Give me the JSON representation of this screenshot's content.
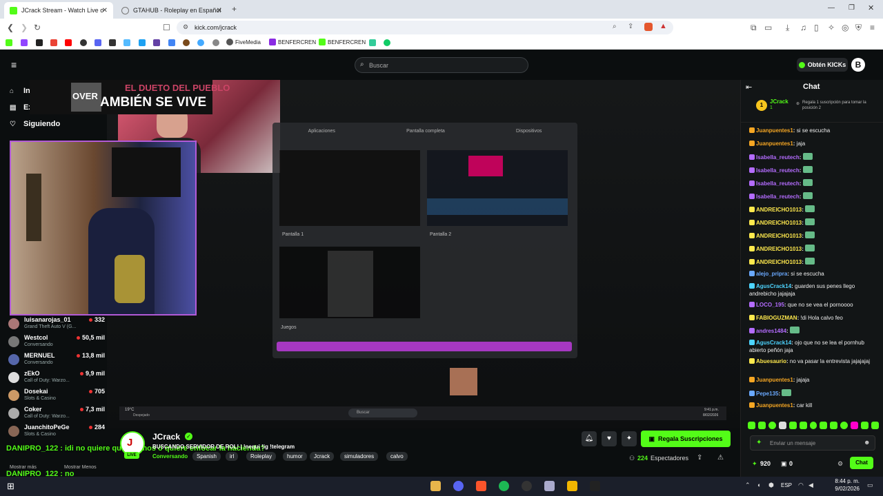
{
  "browser": {
    "tabs": [
      {
        "title": "JCrack Stream - Watch Live o",
        "color": "#53fc18"
      },
      {
        "title": "GTAHUB - Roleplay en Español",
        "color": "#9aa"
      }
    ],
    "url": "kick.com/jcrack",
    "bookmarks": [
      "FiveMedia",
      "BENFERCREN",
      "BENFERCREN"
    ]
  },
  "kick": {
    "search_placeholder": "Buscar",
    "kicks_button": "Obtén KICKs",
    "nav": [
      "Inicio",
      "Explorar",
      "Siguiendo"
    ],
    "overlay_top": "EL DUETO DEL PUEBLO",
    "overlay_main": "AMBIÉN SE VIVE",
    "overlay_logo": "OVER",
    "recommended": [
      {
        "name": "luisanarojas_01",
        "category": "Grand Theft Auto V (G...",
        "viewers": "332",
        "avatar": "#a77"
      },
      {
        "name": "Westcol",
        "category": "Conversando",
        "viewers": "50,5 mil",
        "avatar": "#777"
      },
      {
        "name": "MERNUEL",
        "category": "Conversando",
        "viewers": "13,8 mil",
        "avatar": "#56a"
      },
      {
        "name": "zEkO",
        "category": "Call of Duty: Warzo...",
        "viewers": "9,9 mil",
        "avatar": "#ddd"
      },
      {
        "name": "Dosekai",
        "category": "Slots & Casino",
        "viewers": "705",
        "avatar": "#c96"
      },
      {
        "name": "Coker",
        "category": "Call of Duty: Warzo...",
        "viewers": "7,3 mil",
        "avatar": "#aaa"
      },
      {
        "name": "JuanchitoPeGe",
        "category": "Slots & Casino",
        "viewers": "284",
        "avatar": "#865"
      }
    ],
    "show_more": "Mostrar más",
    "show_less": "Mostrar Menos",
    "float_msg1": "DANIPRO_122 : idi no quiere que veamos o quiere enfocar la hacienda?",
    "float_msg2": "DANIPRO_122 : no",
    "share_screen": {
      "tabs": [
        "Aplicaciones",
        "Pantalla completa",
        "Dispositivos"
      ],
      "screens": [
        "Pantalla 1",
        "Pantalla 2"
      ],
      "games_label": "Juegos"
    },
    "taskbar_inner_search": "Buscar",
    "taskbar_inner_weather": "19°C",
    "taskbar_inner_weather_sub": "Despejado",
    "taskbar_inner_time": "9:41 p.m.",
    "taskbar_inner_date": "8/02/2026",
    "streamer": {
      "name": "JCrack",
      "title": "BUSCANDO SERVIDOR DE ROL! | !nequi !ig !telegram",
      "category": "Conversando",
      "tags": [
        "Spanish",
        "irl",
        "Roleplay",
        "humor",
        "Jcrack",
        "simuladores",
        "calvo"
      ],
      "viewers": "224",
      "viewers_label": "Espectadores",
      "live": "LIVE",
      "gift_button": "Regala Suscripciones"
    },
    "chat": {
      "title": "Chat",
      "pinned_user": "JCrack",
      "pinned_count": "1",
      "pinned_rank": "1",
      "pinned_text": "Regala 1 suscripción para tomar la posición 2",
      "messages": [
        {
          "user": "Juanpuentes1",
          "text": "si se escucha",
          "color": "#f5a623"
        },
        {
          "user": "Juanpuentes1",
          "text": "jaja",
          "color": "#f5a623"
        },
        {
          "user": "Isabella_reutech",
          "text": "",
          "color": "#b46cff"
        },
        {
          "user": "Isabella_reutech",
          "text": "",
          "color": "#b46cff"
        },
        {
          "user": "Isabella_reutech",
          "text": "",
          "color": "#b46cff"
        },
        {
          "user": "Isabella_reutech",
          "text": "",
          "color": "#b46cff"
        },
        {
          "user": "ANDREICHO1013",
          "text": "",
          "color": "#ffe94d"
        },
        {
          "user": "ANDREICHO1013",
          "text": "",
          "color": "#ffe94d"
        },
        {
          "user": "ANDREICHO1013",
          "text": "",
          "color": "#ffe94d"
        },
        {
          "user": "ANDREICHO1013",
          "text": "",
          "color": "#ffe94d"
        },
        {
          "user": "ANDREICHO1013",
          "text": "",
          "color": "#ffe94d"
        },
        {
          "user": "alejo_pripra",
          "text": "si se escucha",
          "color": "#6aa9ff"
        },
        {
          "user": "AgusCrack14",
          "text": "guarden sus penes llego andrebicho jajajaja",
          "color": "#4dd4ff"
        },
        {
          "user": "LOCO_195",
          "text": "que no se vea el pornoooo",
          "color": "#b46cff"
        },
        {
          "user": "FABIOGUZMAN",
          "text": "!di Hola calvo feo",
          "color": "#ffe94d"
        },
        {
          "user": "andres1484",
          "text": "",
          "color": "#b46cff"
        },
        {
          "user": "AgusCrack14",
          "text": "ojo que no se lea el pornhub abierto peñón jaja",
          "color": "#4dd4ff"
        },
        {
          "user": "Abuesaurio",
          "text": "no va pasar la entrevista jajajajaj",
          "color": "#ffe94d"
        },
        {
          "user": "Juanpuentes1",
          "text": "jajaja",
          "color": "#f5a623"
        },
        {
          "user": "Pepe135",
          "text": "",
          "color": "#6aa9ff"
        },
        {
          "user": "Juanpuentes1",
          "text": "car kill",
          "color": "#f5a623"
        }
      ],
      "input_placeholder": "Enviar un mensaje",
      "points": "920",
      "gifts": "0",
      "send_button": "Chat"
    }
  },
  "os": {
    "lang": "ESP",
    "time": "8:44 p. m.",
    "date": "9/02/2026"
  }
}
